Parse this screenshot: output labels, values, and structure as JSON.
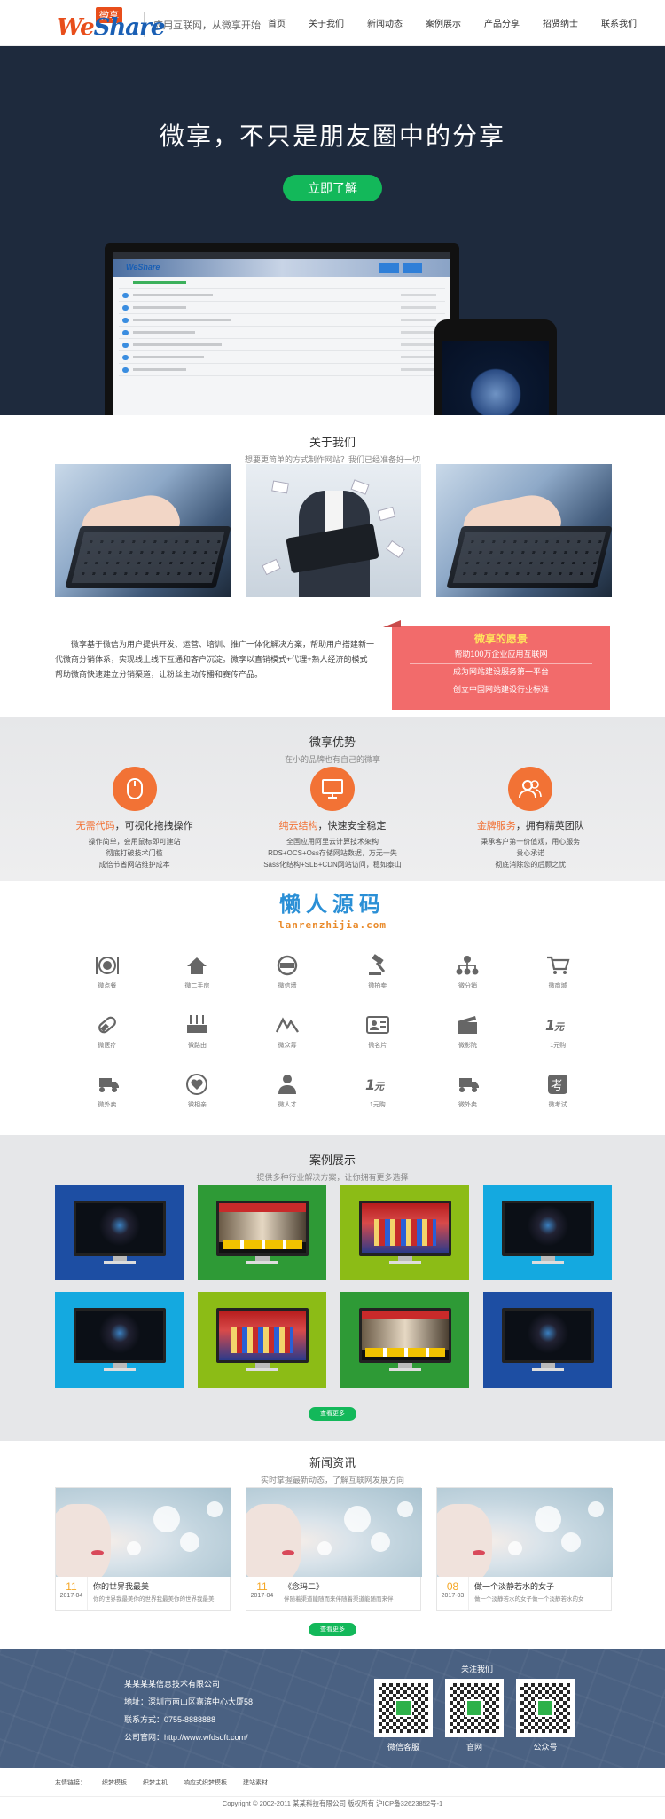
{
  "header": {
    "logo_cn": "微享",
    "logo_en_1": "We",
    "logo_en_2": "Share",
    "slogan": "应用互联网，从微享开始",
    "nav": [
      "首页",
      "关于我们",
      "新闻动态",
      "案例展示",
      "产品分享",
      "招贤纳士",
      "联系我们"
    ]
  },
  "hero": {
    "title": "微享，不只是朋友圈中的分享",
    "button": "立即了解"
  },
  "about": {
    "title": "关于我们",
    "subtitle": "想要更简单的方式制作网站？我们已经准备好一切",
    "text": "微享基于微信为用户提供开发、运营、培训、推广一体化解决方案，帮助用户搭建新一代微商分销体系，实现线上线下互通和客户沉淀。微享以直销模式+代理+熟人经济的模式帮助微商快速建立分销渠道，让粉丝主动传播和赛传产品。",
    "wish_title": "微享的愿景",
    "wish_items": [
      "帮助100万企业应用互联网",
      "成为网站建设服务第一平台",
      "创立中国网站建设行业标准"
    ]
  },
  "advantages": {
    "title": "微享优势",
    "subtitle": "在小的品牌也有自己的微享",
    "items": [
      {
        "hl": "无需代码",
        "rest": "，可视化拖拽操作",
        "desc": [
          "操作简单，会用鼠标即可建站",
          "彻底打破技术门槛",
          "成倍节省网站维护成本"
        ]
      },
      {
        "hl": "纯云结构",
        "rest": "，快速安全稳定",
        "desc": [
          "全国应用阿里云计算技术架构",
          "RDS+OCS+Oss存储网站数据，万无一失",
          "Sass化结构+SLB+CDN网站访问，稳如泰山"
        ]
      },
      {
        "hl": "金牌服务",
        "rest": "，拥有精英团队",
        "desc": [
          "秉承客户第一价值观，用心服务",
          "贵心承诺",
          "彻底消除您的后顾之忧"
        ]
      }
    ]
  },
  "watermark": {
    "cn": "懒人源码",
    "en": "lanrenzhijia.com"
  },
  "icons": [
    {
      "icon": "dining-icon",
      "label": "微点餐"
    },
    {
      "icon": "house-icon",
      "label": "微二手房"
    },
    {
      "icon": "car-icon",
      "label": "微信墙"
    },
    {
      "icon": "gavel-icon",
      "label": "微拍卖"
    },
    {
      "icon": "network-icon",
      "label": "微分销"
    },
    {
      "icon": "cart-icon",
      "label": "微商城"
    },
    {
      "icon": "pill-icon",
      "label": "微医疗"
    },
    {
      "icon": "router-icon",
      "label": "微路由"
    },
    {
      "icon": "crowdfund-icon",
      "label": "微众筹"
    },
    {
      "icon": "id-card-icon",
      "label": "微名片"
    },
    {
      "icon": "clapper-icon",
      "label": "微影院"
    },
    {
      "icon": "one-yuan-icon",
      "label": "1元购"
    },
    {
      "icon": "delivery-icon",
      "label": "微外卖"
    },
    {
      "icon": "heart-icon",
      "label": "微相亲"
    },
    {
      "icon": "person-icon",
      "label": "微人才"
    },
    {
      "icon": "one-yuan-icon",
      "label": "1元购"
    },
    {
      "icon": "delivery-icon",
      "label": "微外卖"
    },
    {
      "icon": "exam-icon",
      "label": "微考试"
    }
  ],
  "cases": {
    "title": "案例展示",
    "subtitle": "提供多种行业解决方案，让你拥有更多选择",
    "tiles": [
      {
        "bg": "#1d4ea3",
        "screen": "dark"
      },
      {
        "bg": "#2e9a36",
        "screen": "red"
      },
      {
        "bg": "#8cbc16",
        "screen": "stage"
      },
      {
        "bg": "#14a9e0",
        "screen": "dark"
      },
      {
        "bg": "#14a9e0",
        "screen": "dark"
      },
      {
        "bg": "#8cbc16",
        "screen": "stage"
      },
      {
        "bg": "#2e9a36",
        "screen": "red"
      },
      {
        "bg": "#1d4ea3",
        "screen": "dark"
      }
    ],
    "more": "查看更多"
  },
  "news": {
    "title": "新闻资讯",
    "subtitle": "实时掌握最新动态，了解互联网发展方向",
    "items": [
      {
        "day": "11",
        "ym": "2017-04",
        "title": "你的世界我最美",
        "summary": "你的世界我最美你的世界我最美你的世界我最美"
      },
      {
        "day": "11",
        "ym": "2017-04",
        "title": "《念玛二》",
        "summary": "伴随着渠道能随而来伴随着渠道能随而来伴"
      },
      {
        "day": "08",
        "ym": "2017-03",
        "title": "做一个淡静若水的女子",
        "summary": "做一个淡静若水的女子做一个淡静若水的女"
      }
    ],
    "more": "查看更多"
  },
  "footer": {
    "company": "某某某某信息技术有限公司",
    "address": "地址：深圳市南山区嘉滨中心大厦58",
    "phone": "联系方式：0755-8888888",
    "site": "公司官网：http://www.wfdsoft.com/",
    "follow": "关注我们",
    "qrs": [
      "微信客服",
      "官网",
      "公众号"
    ],
    "links_label": "友情链接：",
    "links": [
      "织梦模板",
      "织梦主机",
      "响应式织梦模板",
      "建站素材"
    ],
    "copyright": "Copyright © 2002-2011 某某科技有限公司 版权所有 沪ICP备32623852号-1"
  }
}
